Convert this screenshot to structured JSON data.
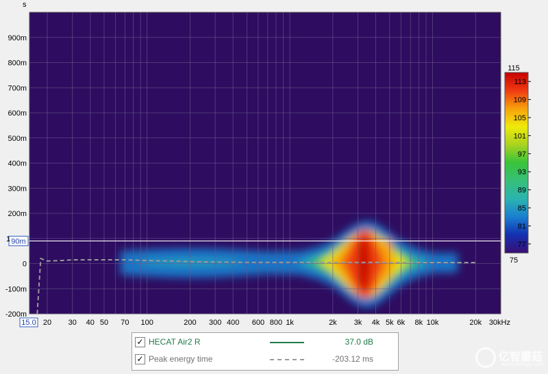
{
  "chart_data": {
    "type": "heatmap",
    "title": "",
    "xlabel": "",
    "x_unit_label": "30kHz",
    "ylabel": "s",
    "x_scale": "log",
    "xlim": [
      15,
      30000
    ],
    "ylim": [
      -0.2,
      1.0
    ],
    "grid": true,
    "x_ticks": [
      {
        "value": 20,
        "label": "20"
      },
      {
        "value": 30,
        "label": "30"
      },
      {
        "value": 40,
        "label": "40"
      },
      {
        "value": 50,
        "label": "50"
      },
      {
        "value": 70,
        "label": "70"
      },
      {
        "value": 100,
        "label": "100"
      },
      {
        "value": 200,
        "label": "200"
      },
      {
        "value": 300,
        "label": "300"
      },
      {
        "value": 400,
        "label": "400"
      },
      {
        "value": 600,
        "label": "600"
      },
      {
        "value": 800,
        "label": "800"
      },
      {
        "value": 1000,
        "label": "1k"
      },
      {
        "value": 2000,
        "label": "2k"
      },
      {
        "value": 3000,
        "label": "3k"
      },
      {
        "value": 4000,
        "label": "4k"
      },
      {
        "value": 5000,
        "label": "5k"
      },
      {
        "value": 6000,
        "label": "6k"
      },
      {
        "value": 8000,
        "label": "8k"
      },
      {
        "value": 10000,
        "label": "10k"
      },
      {
        "value": 20000,
        "label": "20k"
      }
    ],
    "x_start_label": "15.0",
    "y_ticks": [
      {
        "value": 0.9,
        "label": "900m"
      },
      {
        "value": 0.8,
        "label": "800m"
      },
      {
        "value": 0.7,
        "label": "700m"
      },
      {
        "value": 0.6,
        "label": "600m"
      },
      {
        "value": 0.5,
        "label": "500m"
      },
      {
        "value": 0.4,
        "label": "400m"
      },
      {
        "value": 0.3,
        "label": "300m"
      },
      {
        "value": 0.2,
        "label": "200m"
      },
      {
        "value": 0.1,
        "label": "1"
      },
      {
        "value": 0.0,
        "label": "0"
      },
      {
        "value": -0.1,
        "label": "-100m"
      },
      {
        "value": -0.2,
        "label": "-200m"
      }
    ],
    "cursor_value": 0.09,
    "cursor_label": "90m",
    "colorscale": {
      "min": 75,
      "max": 115,
      "min_label": "75",
      "max_label": "115",
      "ticks": [
        "113",
        "109",
        "105",
        "101",
        "97",
        "93",
        "89",
        "85",
        "81",
        "77"
      ],
      "tick_values": [
        113,
        109,
        105,
        101,
        97,
        93,
        89,
        85,
        81,
        77
      ],
      "colors": [
        "#3a0e73",
        "#1330b0",
        "#1a7fd0",
        "#2bb3b0",
        "#36c07a",
        "#39c33a",
        "#a9d320",
        "#f0ea0a",
        "#f7a10d",
        "#ef3a12",
        "#c80000"
      ]
    },
    "energy_blobs": [
      {
        "freq": 3300,
        "time": 0.0,
        "freq_spread": 0.42,
        "time_spread": 0.12,
        "level": 1.0
      },
      {
        "freq": 4800,
        "time": 0.02,
        "freq_spread": 0.25,
        "time_spread": 0.1,
        "level": 0.8
      },
      {
        "freq": 2200,
        "time": 0.0,
        "freq_spread": 0.3,
        "time_spread": 0.07,
        "level": 0.55
      },
      {
        "freq": 200,
        "time": 0.0,
        "freq_spread": 1.0,
        "time_spread": 0.05,
        "level": 0.35
      },
      {
        "freq": 1000,
        "time": 0.0,
        "freq_spread": 0.4,
        "time_spread": 0.05,
        "level": 0.3
      }
    ],
    "series": [
      {
        "name": "Peak energy time",
        "style": "dashed",
        "color": "#9a9a9a",
        "x": [
          17,
          18,
          20,
          25,
          30,
          40,
          50,
          70,
          100,
          150,
          200,
          300,
          500,
          1000,
          2000,
          3000,
          4000,
          6000,
          10000,
          20000
        ],
        "y": [
          -0.2,
          0.02,
          0.01,
          0.012,
          0.015,
          0.015,
          0.015,
          0.015,
          0.012,
          0.01,
          0.008,
          0.006,
          0.005,
          0.005,
          0.005,
          0.005,
          0.005,
          0.004,
          0.004,
          0.004
        ]
      }
    ]
  },
  "legend": {
    "items": [
      {
        "label": "HECAT Air2 R",
        "value": "37.0 dB",
        "color": "#1e7a46",
        "style": "solid",
        "checked": "✓"
      },
      {
        "label": "Peak energy time",
        "value": "-203.12 ms",
        "color": "#9a9a9a",
        "style": "dashed",
        "checked": "✓"
      }
    ]
  },
  "watermark": {
    "text": "亿智蘑菇",
    "url": "www.yizhigu.com"
  },
  "colors": {
    "plot_bg": "#2e0c60",
    "grid": "#6a5a8c",
    "cursor_line": "#ffffff",
    "axis_text": "#000000",
    "page_bg": "#f0f0f0"
  }
}
